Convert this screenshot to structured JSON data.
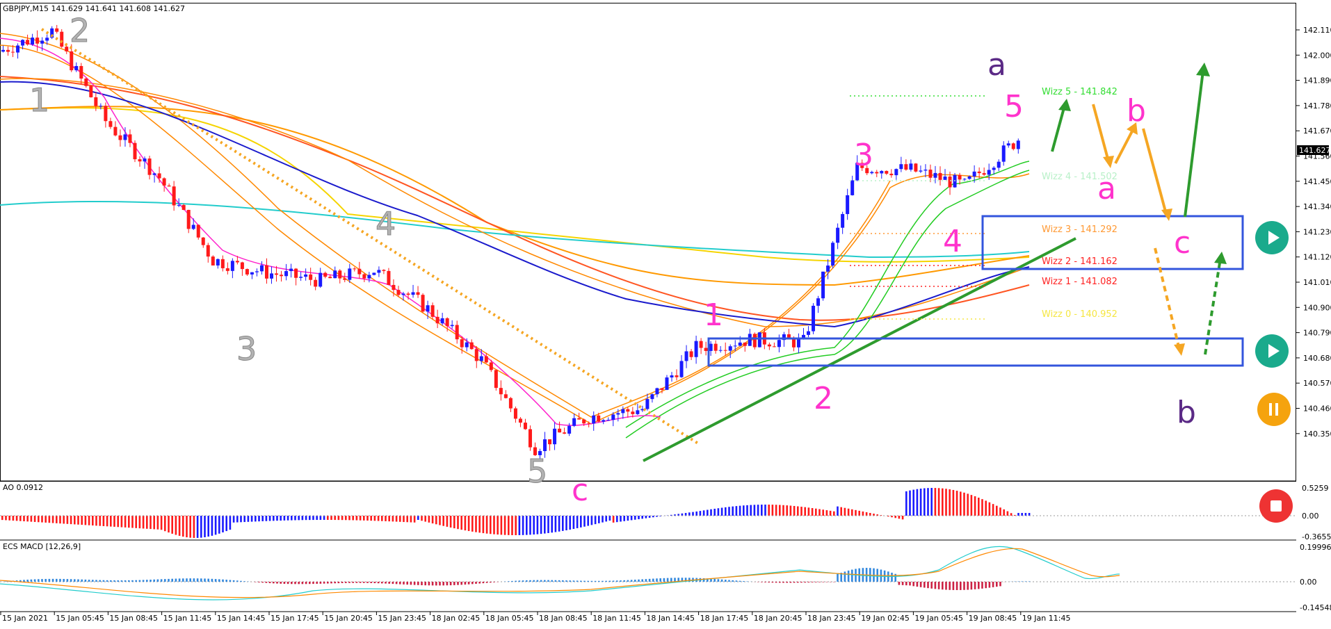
{
  "header": {
    "symbol_line": "GBPJPY,M15  141.629 141.641 141.608 141.627"
  },
  "price_axis": {
    "ticks": [
      "142.110",
      "142.000",
      "141.890",
      "141.780",
      "141.670",
      "141.560",
      "141.450",
      "141.340",
      "141.230",
      "141.120",
      "141.010",
      "140.900",
      "140.790",
      "140.680",
      "140.570",
      "140.460",
      "140.350"
    ],
    "current_price": "141.627"
  },
  "time_axis": {
    "ticks": [
      "15 Jan 2021",
      "15 Jan 05:45",
      "15 Jan 08:45",
      "15 Jan 11:45",
      "15 Jan 14:45",
      "15 Jan 17:45",
      "15 Jan 20:45",
      "15 Jan 23:45",
      "18 Jan 02:45",
      "18 Jan 05:45",
      "18 Jan 08:45",
      "18 Jan 11:45",
      "18 Jan 14:45",
      "18 Jan 17:45",
      "18 Jan 20:45",
      "18 Jan 23:45",
      "19 Jan 02:45",
      "19 Jan 05:45",
      "19 Jan 08:45",
      "19 Jan 11:45"
    ]
  },
  "ao_pane": {
    "label": "AO 0.0912",
    "ticks": [
      "0.5259",
      "0.00",
      "-0.3655"
    ]
  },
  "macd_pane": {
    "label": "ECS MACD [12,26,9]",
    "ticks": [
      "0.19996",
      "0.00",
      "-0.14548"
    ]
  },
  "wizz_levels": [
    {
      "label": "Wizz 5 - 141.842",
      "color": "#33dd33"
    },
    {
      "label": "Wizz 4 - 141.502",
      "color": "#b8f0c8"
    },
    {
      "label": "Wizz 3 - 141.292",
      "color": "#ff9933"
    },
    {
      "label": "Wizz 2 - 141.162",
      "color": "#ff2222"
    },
    {
      "label": "Wizz 1 - 141.082",
      "color": "#ff2222"
    },
    {
      "label": "Wizz 0 - 140.952",
      "color": "#f5e642"
    }
  ],
  "wave_labels": {
    "gray": [
      "1",
      "2",
      "3",
      "4",
      "5"
    ],
    "pink_c": "c",
    "pink": [
      "1",
      "2",
      "3",
      "4",
      "5"
    ],
    "purple_a": "a",
    "purple_b": "b",
    "pink_a": "a",
    "pink_b": "b",
    "pink_c2": "c"
  },
  "icons": [
    "play-icon",
    "play-icon",
    "pause-icon",
    "stop-icon"
  ],
  "colors": {
    "bull": "#1a1aff",
    "bear": "#ff1a1a",
    "trend_green": "#2e9b2e",
    "trend_orange_dotted": "#f5a623",
    "zone_box": "#3355dd",
    "play_btn": "#1aaa8c",
    "pause_btn": "#f5a30e",
    "stop_btn": "#ee3333"
  },
  "chart_data": {
    "type": "candlestick",
    "symbol": "GBPJPY",
    "timeframe": "M15",
    "ylim": [
      140.3,
      142.16
    ],
    "approx_close_path": [
      {
        "t": "15 Jan 2021",
        "close": 141.97
      },
      {
        "t": "15 Jan 05:45",
        "close": 142.05
      },
      {
        "t": "15 Jan 08:45",
        "close": 141.7
      },
      {
        "t": "15 Jan 11:45",
        "close": 141.48
      },
      {
        "t": "15 Jan 14:45",
        "close": 141.16
      },
      {
        "t": "15 Jan 17:45",
        "close": 141.11
      },
      {
        "t": "15 Jan 20:45",
        "close": 141.08
      },
      {
        "t": "15 Jan 23:45",
        "close": 141.12
      },
      {
        "t": "18 Jan 02:45",
        "close": 140.97
      },
      {
        "t": "18 Jan 05:45",
        "close": 140.77
      },
      {
        "t": "18 Jan 08:45",
        "close": 140.43
      },
      {
        "t": "18 Jan 11:45",
        "close": 140.55
      },
      {
        "t": "18 Jan 14:45",
        "close": 140.58
      },
      {
        "t": "18 Jan 17:45",
        "close": 140.82
      },
      {
        "t": "18 Jan 20:45",
        "close": 140.85
      },
      {
        "t": "18 Jan 23:45",
        "close": 140.84
      },
      {
        "t": "19 Jan 02:45",
        "close": 141.52
      },
      {
        "t": "19 Jan 05:45",
        "close": 141.51
      },
      {
        "t": "19 Jan 08:45",
        "close": 141.45
      },
      {
        "t": "19 Jan 11:45",
        "close": 141.63
      }
    ]
  }
}
